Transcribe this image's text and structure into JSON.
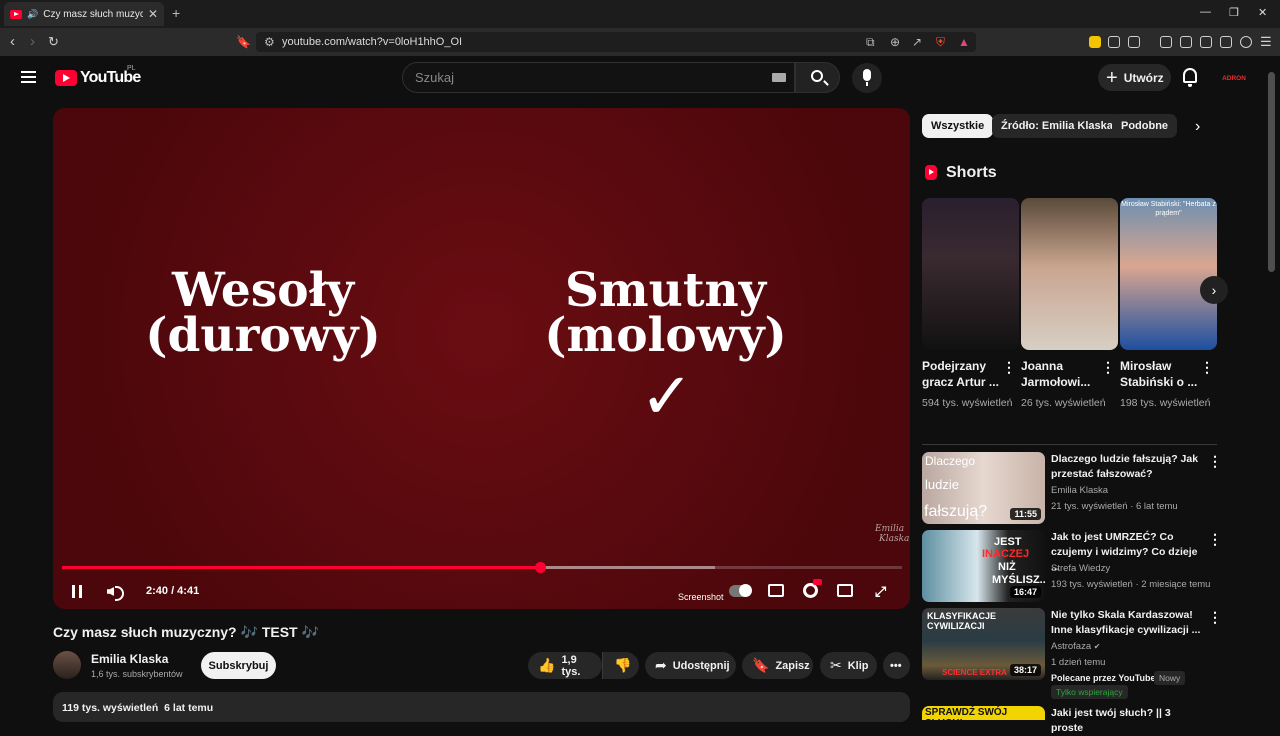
{
  "browser": {
    "tab_title": "Czy masz słuch muzyczny? 🎶 TEST 🎶",
    "url": "youtube.com/watch?v=0loH1hhO_OI"
  },
  "header": {
    "logo_text": "YouTube",
    "country_code": "PL",
    "search_placeholder": "Szukaj",
    "create_label": "Utwórz",
    "avatar_text": "ADRON"
  },
  "player": {
    "left_word": "Wesoły",
    "left_sub": "(durowy)",
    "right_word": "Smutny",
    "right_sub": "(molowy)",
    "check_mark": "✓",
    "signature_line1": "Emilia",
    "signature_line2": "Klaska",
    "time_display": "2:40 / 4:41",
    "played_fraction": 0.569,
    "loaded_fraction": 0.777,
    "screenshot_label": "Screenshot"
  },
  "video": {
    "title": "Czy masz słuch muzyczny? 🎶 TEST 🎶",
    "channel_name": "Emilia Klaska",
    "channel_subs": "1,6 tys. subskrybentów",
    "subscribe_label": "Subskrybuj",
    "likes_label": "1,9 tys.",
    "share_label": "Udostępnij",
    "save_label": "Zapisz",
    "clip_label": "Klip",
    "views_label": "119 tys. wyświetleń",
    "age_label": "6 lat temu"
  },
  "sidebar": {
    "chips": [
      "Wszystkie",
      "Źródło: Emilia Klaska",
      "Podobne"
    ],
    "shorts_heading": "Shorts",
    "shorts": [
      {
        "title": "Podejrzany gracz Artur ...",
        "views": "594 tys. wyświetleń",
        "thumb_text": ""
      },
      {
        "title": "Joanna Jarmołowi...",
        "views": "26 tys. wyświetleń",
        "thumb_text": ""
      },
      {
        "title": "Mirosław Stabiński o ...",
        "views": "198 tys. wyświetleń",
        "thumb_text": "Mirosław Stabiński: \"Herbata z prądem\""
      }
    ],
    "recommended": [
      {
        "title": "Dlaczego ludzie fałszują? Jak przestać fałszować?",
        "channel": "Emilia Klaska",
        "meta": "21 tys. wyświetleń · 6 lat temu",
        "duration": "11:55",
        "thumb_lines": [
          "Dlaczego",
          "ludzie",
          "fałszują?"
        ]
      },
      {
        "title": "Jak to jest UMRZEĆ? Co czujemy i widzimy? Co dzieje ...",
        "channel": "Strefa Wiedzy",
        "meta": "193 tys. wyświetleń · 2 miesiące temu",
        "duration": "16:47",
        "thumb_lines": [
          "JEST",
          "INACZEJ",
          "NIŻ",
          "MYŚLISZ..."
        ]
      },
      {
        "title": "Nie tylko Skala Kardaszowa! Inne klasyfikacje cywilizacji ...",
        "channel": "Astrofaza",
        "meta": "1 dzień temu",
        "duration": "38:17",
        "promoted": "Polecane przez YouTube",
        "new_badge": "Nowy",
        "members_badge": "Tylko wspierający",
        "thumb_lines": [
          "KLASYFIKACJE CYWILIZACJI",
          "SCIENCE EXTRA"
        ]
      },
      {
        "title": "Jaki jest twój słuch? || 3 proste",
        "thumb_lines": [
          "SPRAWDŹ SWÓJ SŁUCH!"
        ]
      }
    ]
  }
}
